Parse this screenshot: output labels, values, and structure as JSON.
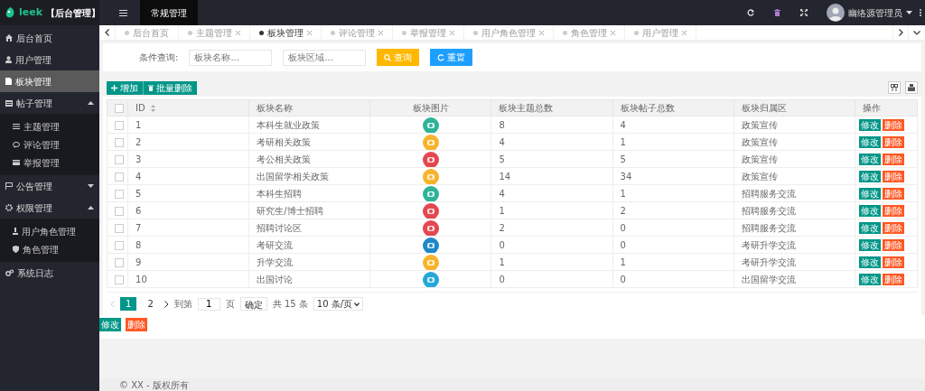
{
  "brand": {
    "name": "leek",
    "title": "【后台管理】"
  },
  "topnav": {
    "items": [
      {
        "label": "常规管理",
        "selected": true
      }
    ]
  },
  "user": {
    "name": "幽络源管理员"
  },
  "sidebar": {
    "items": [
      {
        "label": "后台首页",
        "selected": false
      },
      {
        "label": "用户管理",
        "selected": false
      },
      {
        "label": "板块管理",
        "selected": true
      },
      {
        "label": "帖子管理",
        "selected": false,
        "expanded": true,
        "children": [
          {
            "label": "主题管理",
            "selected": false
          },
          {
            "label": "评论管理",
            "selected": false
          },
          {
            "label": "举报管理",
            "selected": false
          }
        ]
      },
      {
        "label": "公告管理",
        "selected": false,
        "expanded": false
      },
      {
        "label": "权限管理",
        "selected": false,
        "expanded": true,
        "children": [
          {
            "label": "用户角色管理",
            "selected": false
          },
          {
            "label": "角色管理",
            "selected": false
          }
        ]
      },
      {
        "label": "系统日志",
        "selected": false
      }
    ]
  },
  "tabs": [
    {
      "label": "后台首页",
      "selected": false,
      "closable": false
    },
    {
      "label": "主题管理",
      "selected": false,
      "closable": true
    },
    {
      "label": "板块管理",
      "selected": true,
      "closable": true
    },
    {
      "label": "评论管理",
      "selected": false,
      "closable": true
    },
    {
      "label": "举报管理",
      "selected": false,
      "closable": true
    },
    {
      "label": "用户角色管理",
      "selected": false,
      "closable": true
    },
    {
      "label": "角色管理",
      "selected": false,
      "closable": true
    },
    {
      "label": "用户管理",
      "selected": false,
      "closable": true
    }
  ],
  "search": {
    "label": "条件查询:",
    "fields": [
      {
        "placeholder": "板块名称..."
      },
      {
        "placeholder": "板块区域..."
      }
    ],
    "buttons": [
      {
        "label": "查询",
        "kind": "search"
      },
      {
        "label": "重置",
        "kind": "reset"
      }
    ]
  },
  "toolbar": {
    "buttons": [
      {
        "label": "增加",
        "kind": "add"
      },
      {
        "label": "批量删除",
        "kind": "delete"
      }
    ]
  },
  "table": {
    "all_checked": false,
    "columns": [
      "ID",
      "板块名称",
      "板块图片",
      "板块主题总数",
      "板块帖子总数",
      "板块归属区",
      "操作"
    ],
    "rows": [
      {
        "checked": false,
        "id": "1",
        "name": "本科生就业政策",
        "color": "#2eb398",
        "topics": "8",
        "posts": "4",
        "area": "政策宣传",
        "actions": [
          "修改",
          "删除"
        ]
      },
      {
        "checked": false,
        "id": "2",
        "name": "考研相关政策",
        "color": "#f7b32b",
        "topics": "4",
        "posts": "1",
        "area": "政策宣传",
        "actions": [
          "修改",
          "删除"
        ]
      },
      {
        "checked": false,
        "id": "3",
        "name": "考公相关政策",
        "color": "#e5474f",
        "topics": "5",
        "posts": "5",
        "area": "政策宣传",
        "actions": [
          "修改",
          "删除"
        ]
      },
      {
        "checked": false,
        "id": "4",
        "name": "出国留学相关政策",
        "color": "#f7b32b",
        "topics": "14",
        "posts": "34",
        "area": "政策宣传",
        "actions": [
          "修改",
          "删除"
        ]
      },
      {
        "checked": false,
        "id": "5",
        "name": "本科生招聘",
        "color": "#2eb398",
        "topics": "4",
        "posts": "1",
        "area": "招聘服务交流",
        "actions": [
          "修改",
          "删除"
        ]
      },
      {
        "checked": false,
        "id": "6",
        "name": "研究生/博士招聘",
        "color": "#e5474f",
        "topics": "1",
        "posts": "2",
        "area": "招聘服务交流",
        "actions": [
          "修改",
          "删除"
        ]
      },
      {
        "checked": false,
        "id": "7",
        "name": "招聘讨论区",
        "color": "#e5474f",
        "topics": "2",
        "posts": "0",
        "area": "招聘服务交流",
        "actions": [
          "修改",
          "删除"
        ]
      },
      {
        "checked": false,
        "id": "8",
        "name": "考研交流",
        "color": "#1e88c8",
        "topics": "0",
        "posts": "0",
        "area": "考研升学交流",
        "actions": [
          "修改",
          "删除"
        ]
      },
      {
        "checked": false,
        "id": "9",
        "name": "升学交流",
        "color": "#f7b32b",
        "topics": "1",
        "posts": "1",
        "area": "考研升学交流",
        "actions": [
          "修改",
          "删除"
        ]
      },
      {
        "checked": false,
        "id": "10",
        "name": "出国讨论",
        "color": "#26a8d8",
        "topics": "0",
        "posts": "0",
        "area": "出国留学交流",
        "actions": [
          "修改",
          "删除"
        ]
      }
    ]
  },
  "pager": {
    "pages": [
      {
        "label": "1",
        "selected": true
      },
      {
        "label": "2",
        "selected": false
      }
    ],
    "goto_label": "到第",
    "goto_value": "1",
    "page_label": "页",
    "confirm": "确定",
    "total": "共 15 条",
    "page_size": "10 条/页"
  },
  "bottom_buttons": [
    "修改",
    "删除"
  ],
  "footer": "© XX - 版权所有"
}
